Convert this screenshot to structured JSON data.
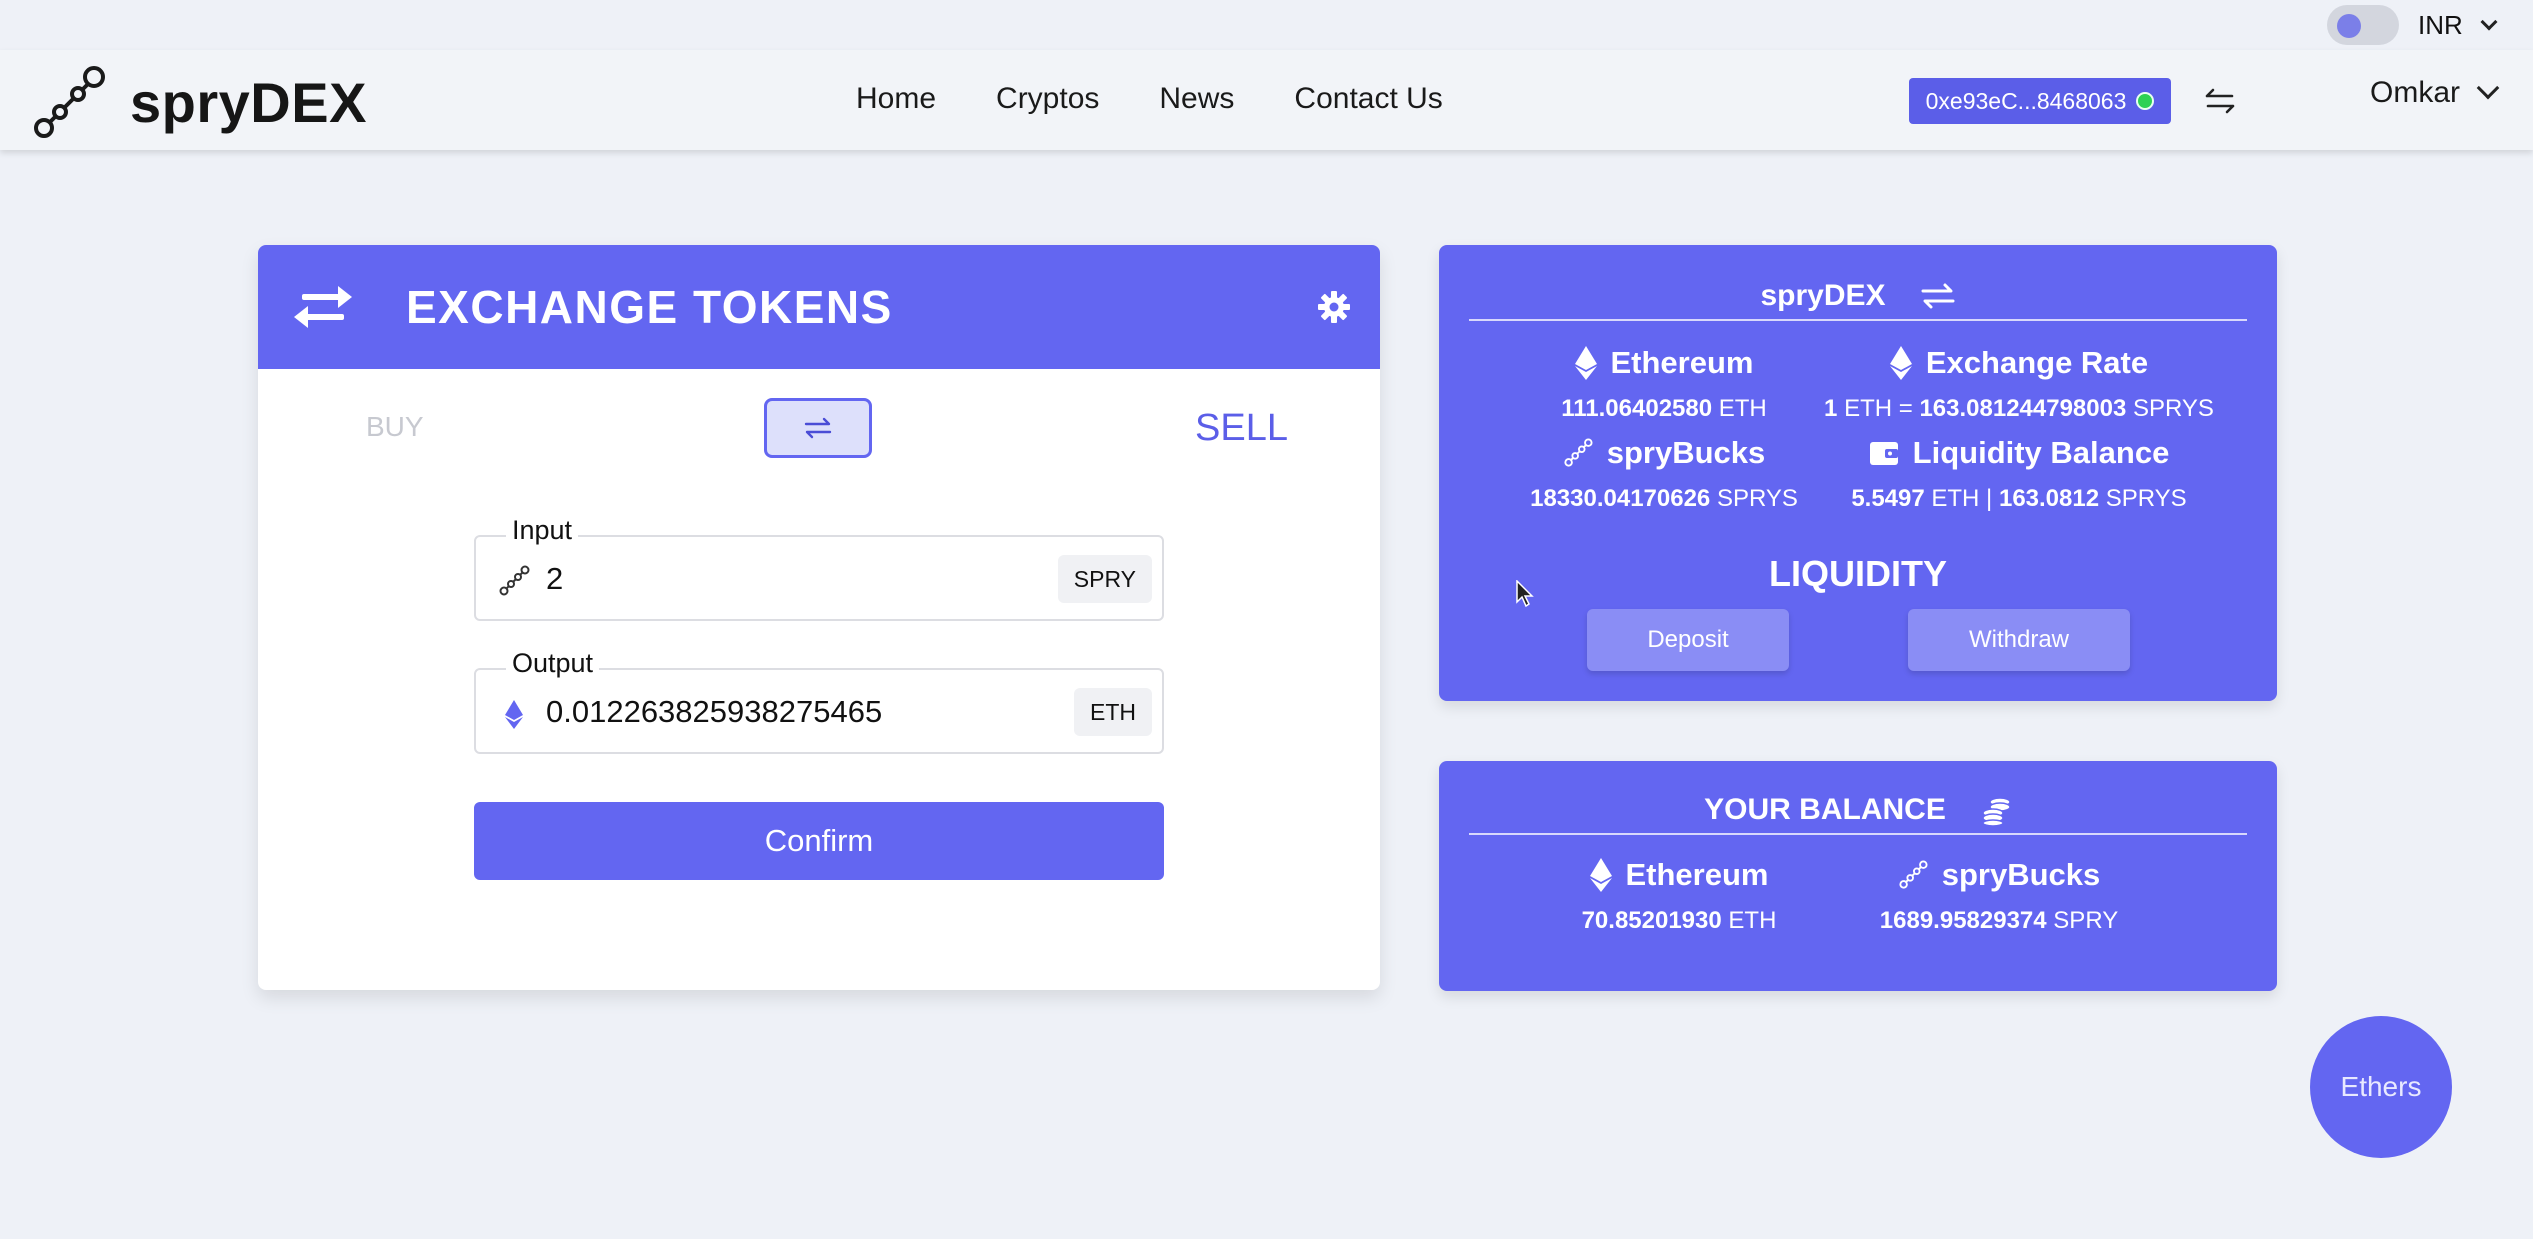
{
  "topbar": {
    "currency": "INR"
  },
  "navbar": {
    "brand": "spryDEX",
    "links": [
      "Home",
      "Cryptos",
      "News",
      "Contact Us"
    ],
    "wallet_address": "0xe93eC...8468063",
    "user": "Omkar"
  },
  "exchange": {
    "title": "EXCHANGE TOKENS",
    "buy_label": "BUY",
    "sell_label": "SELL",
    "input": {
      "legend": "Input",
      "value": "2",
      "token": "SPRY"
    },
    "output": {
      "legend": "Output",
      "value": "0.012263825938275465",
      "token": "ETH"
    },
    "confirm_label": "Confirm"
  },
  "dex_card": {
    "title": "spryDEX",
    "ethereum": {
      "label": "Ethereum",
      "amount": "111.06402580",
      "unit": "ETH"
    },
    "exchange_rate": {
      "label": "Exchange Rate",
      "lhs": "1",
      "lhs_unit": "ETH =",
      "rhs": "163.081244798003",
      "rhs_unit": "SPRYS"
    },
    "sprybucks": {
      "label": "spryBucks",
      "amount": "18330.04170626",
      "unit": "SPRYS"
    },
    "liquidity_balance": {
      "label": "Liquidity Balance",
      "eth": "5.5497",
      "eth_unit": "ETH |",
      "spry": "163.0812",
      "spry_unit": "SPRYS"
    },
    "liquidity_title": "LIQUIDITY",
    "deposit_label": "Deposit",
    "withdraw_label": "Withdraw"
  },
  "balance_card": {
    "title": "YOUR BALANCE",
    "ethereum": {
      "label": "Ethereum",
      "amount": "70.85201930",
      "unit": "ETH"
    },
    "sprybucks": {
      "label": "spryBucks",
      "amount": "1689.95829374",
      "unit": "SPRY"
    }
  },
  "fab_label": "Ethers",
  "colors": {
    "primary": "#6366f1",
    "wallet_online": "#2ed154",
    "page_bg": "#eef1f7"
  }
}
